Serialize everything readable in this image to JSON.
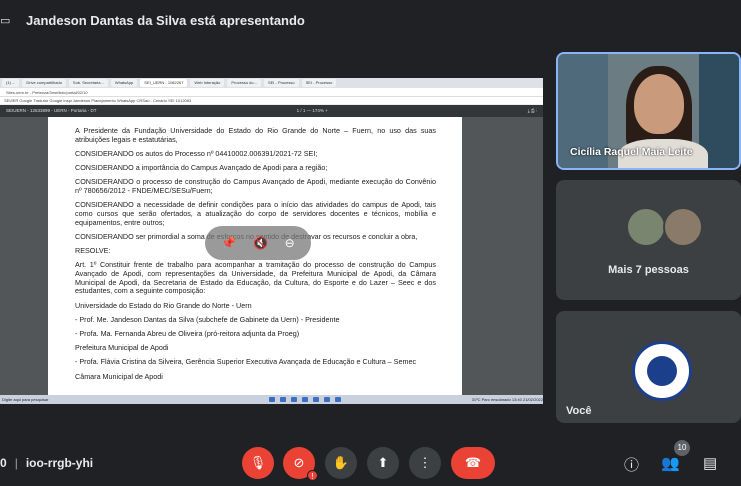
{
  "header": {
    "presenting_text": "Jandeson Dantas da Silva está apresentando"
  },
  "shared_screen": {
    "tabs": [
      "(1) ...",
      "Drive compartilhado",
      "Sob. Secretaria...",
      "WhatsApp",
      "SEI_UERN - 1082267",
      "Web Interação",
      "Processo do...",
      "SEI - Processo",
      "SEI - Processo"
    ],
    "address": "Sites.uern.br - Pretenza/3mw/bdc/portal/02/10",
    "bookmarks": "SEI/IER   Google Tradutor   Google   Inspi   Jandeson   Planejamento   WhatsApp   CRSaú - Cenário   SEI 1012083",
    "pdf_toolbar_left": "SEIUERN - 12633899 - UERN - Portaria - DT",
    "pdf_toolbar_center": "1 / 1   —   174%   +",
    "document_paragraphs": [
      "A Presidente da Fundação Universidade do Estado do Rio Grande do Norte – Fuern, no uso das suas atribuições legais e estatutárias,",
      "CONSIDERANDO os autos do Processo nº 04410002.006391/2021-72 SEI;",
      "CONSIDERANDO a importância do Campus Avançado de Apodi para a região;",
      "CONSIDERANDO o processo de construção do Campus Avançado de Apodi, mediante execução do Convênio nº 780656/2012 - FNDE/MEC/SESu/Fuern;",
      "CONSIDERANDO a necessidade de definir condições para o início das atividades do campus de Apodi, tais como cursos que serão ofertados, a atualização do corpo de servidores docentes e técnicos, mobília e equipamentos, entre outros;",
      "CONSIDERANDO ser primordial a soma de esforços no sentido de destravar os recursos e concluir a obra,",
      "RESOLVE:",
      "Art. 1º Constituir frente de trabalho para acompanhar a tramitação do processo de construção do Campus Avançado de Apodi, com representações da Universidade, da Prefeitura Municipal de Apodi, da Câmara Municipal de Apodi, da Secretaria de Estado da Educação, da Cultura, do Esporte e do Lazer – Seec e dos estudantes, com a seguinte composição:",
      "Universidade do Estado do Rio Grande do Norte - Uern",
      "- Prof. Me. Jandeson Dantas da Silva (subchefe de Gabinete da Uern) - Presidente",
      "- Profa. Ma. Fernanda Abreu de Oliveira (pró-reitora adjunta da Proeg)",
      "Prefeitura Municipal de Apodi",
      "- Profa. Flávia Cristina da Silveira, Gerência Superior Executiva Avançada de Educação e Cultura – Semec",
      "Câmara Municipal de Apodi"
    ],
    "taskbar_left": "Digite aqui para pesquisar",
    "taskbar_right": "31ºC Parc ensolarado   13:40   21/02/2022"
  },
  "participants": [
    {
      "name": "Cicília Raquel Maia Leite"
    },
    {
      "more_label": "Mais 7 pessoas"
    },
    {
      "self_label": "Você"
    }
  ],
  "bottom": {
    "time": "0",
    "meeting_code": "ioo-rrgb-yhi",
    "people_count": "10"
  },
  "icons": [
    "present-icon",
    "mic-off-icon",
    "camera-off-icon",
    "raise-hand-icon",
    "present-screen-icon",
    "more-options-icon",
    "hangup-icon",
    "info-icon",
    "people-icon",
    "chat-icon"
  ]
}
